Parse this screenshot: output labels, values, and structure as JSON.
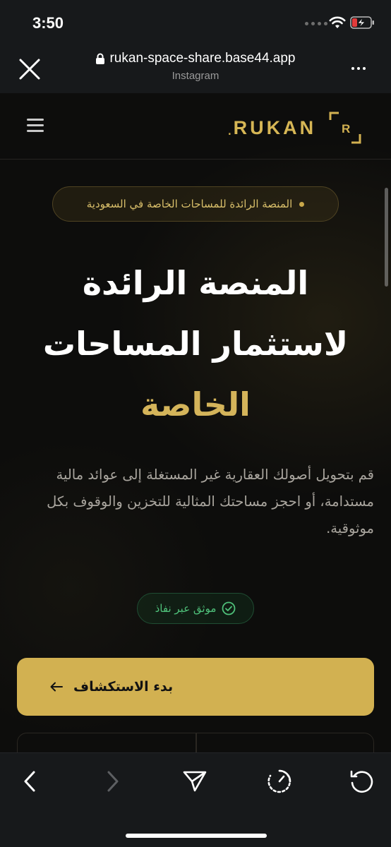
{
  "status_bar": {
    "time": "3:50"
  },
  "browser": {
    "url": "rukan-space-share.base44.app",
    "source": "Instagram"
  },
  "header": {
    "brand": "RUKAN",
    "brand_dot": ".",
    "logo_letter": "R"
  },
  "hero": {
    "tagline": "المنصة الرائدة للمساحات الخاصة في السعودية",
    "title_line1": "المنصة الرائدة",
    "title_line2": "لاستثمار المساحات",
    "title_highlight": "الخاصة",
    "description": "قم بتحويل أصولك العقارية غير المستغلة إلى عوائد مالية مستدامة، أو احجز مساحتك المثالية للتخزين والوقوف بكل موثوقية.",
    "verified_label": "موثق عبر نفاذ",
    "cta_label": "بدء الاستكشاف"
  },
  "colors": {
    "accent_gold": "#d2b151",
    "verified_green": "#4fc17a",
    "background": "#0d0d0c"
  },
  "icons": {
    "toolbar": [
      "back-icon",
      "forward-icon",
      "share-icon",
      "timer-icon",
      "refresh-icon"
    ]
  }
}
